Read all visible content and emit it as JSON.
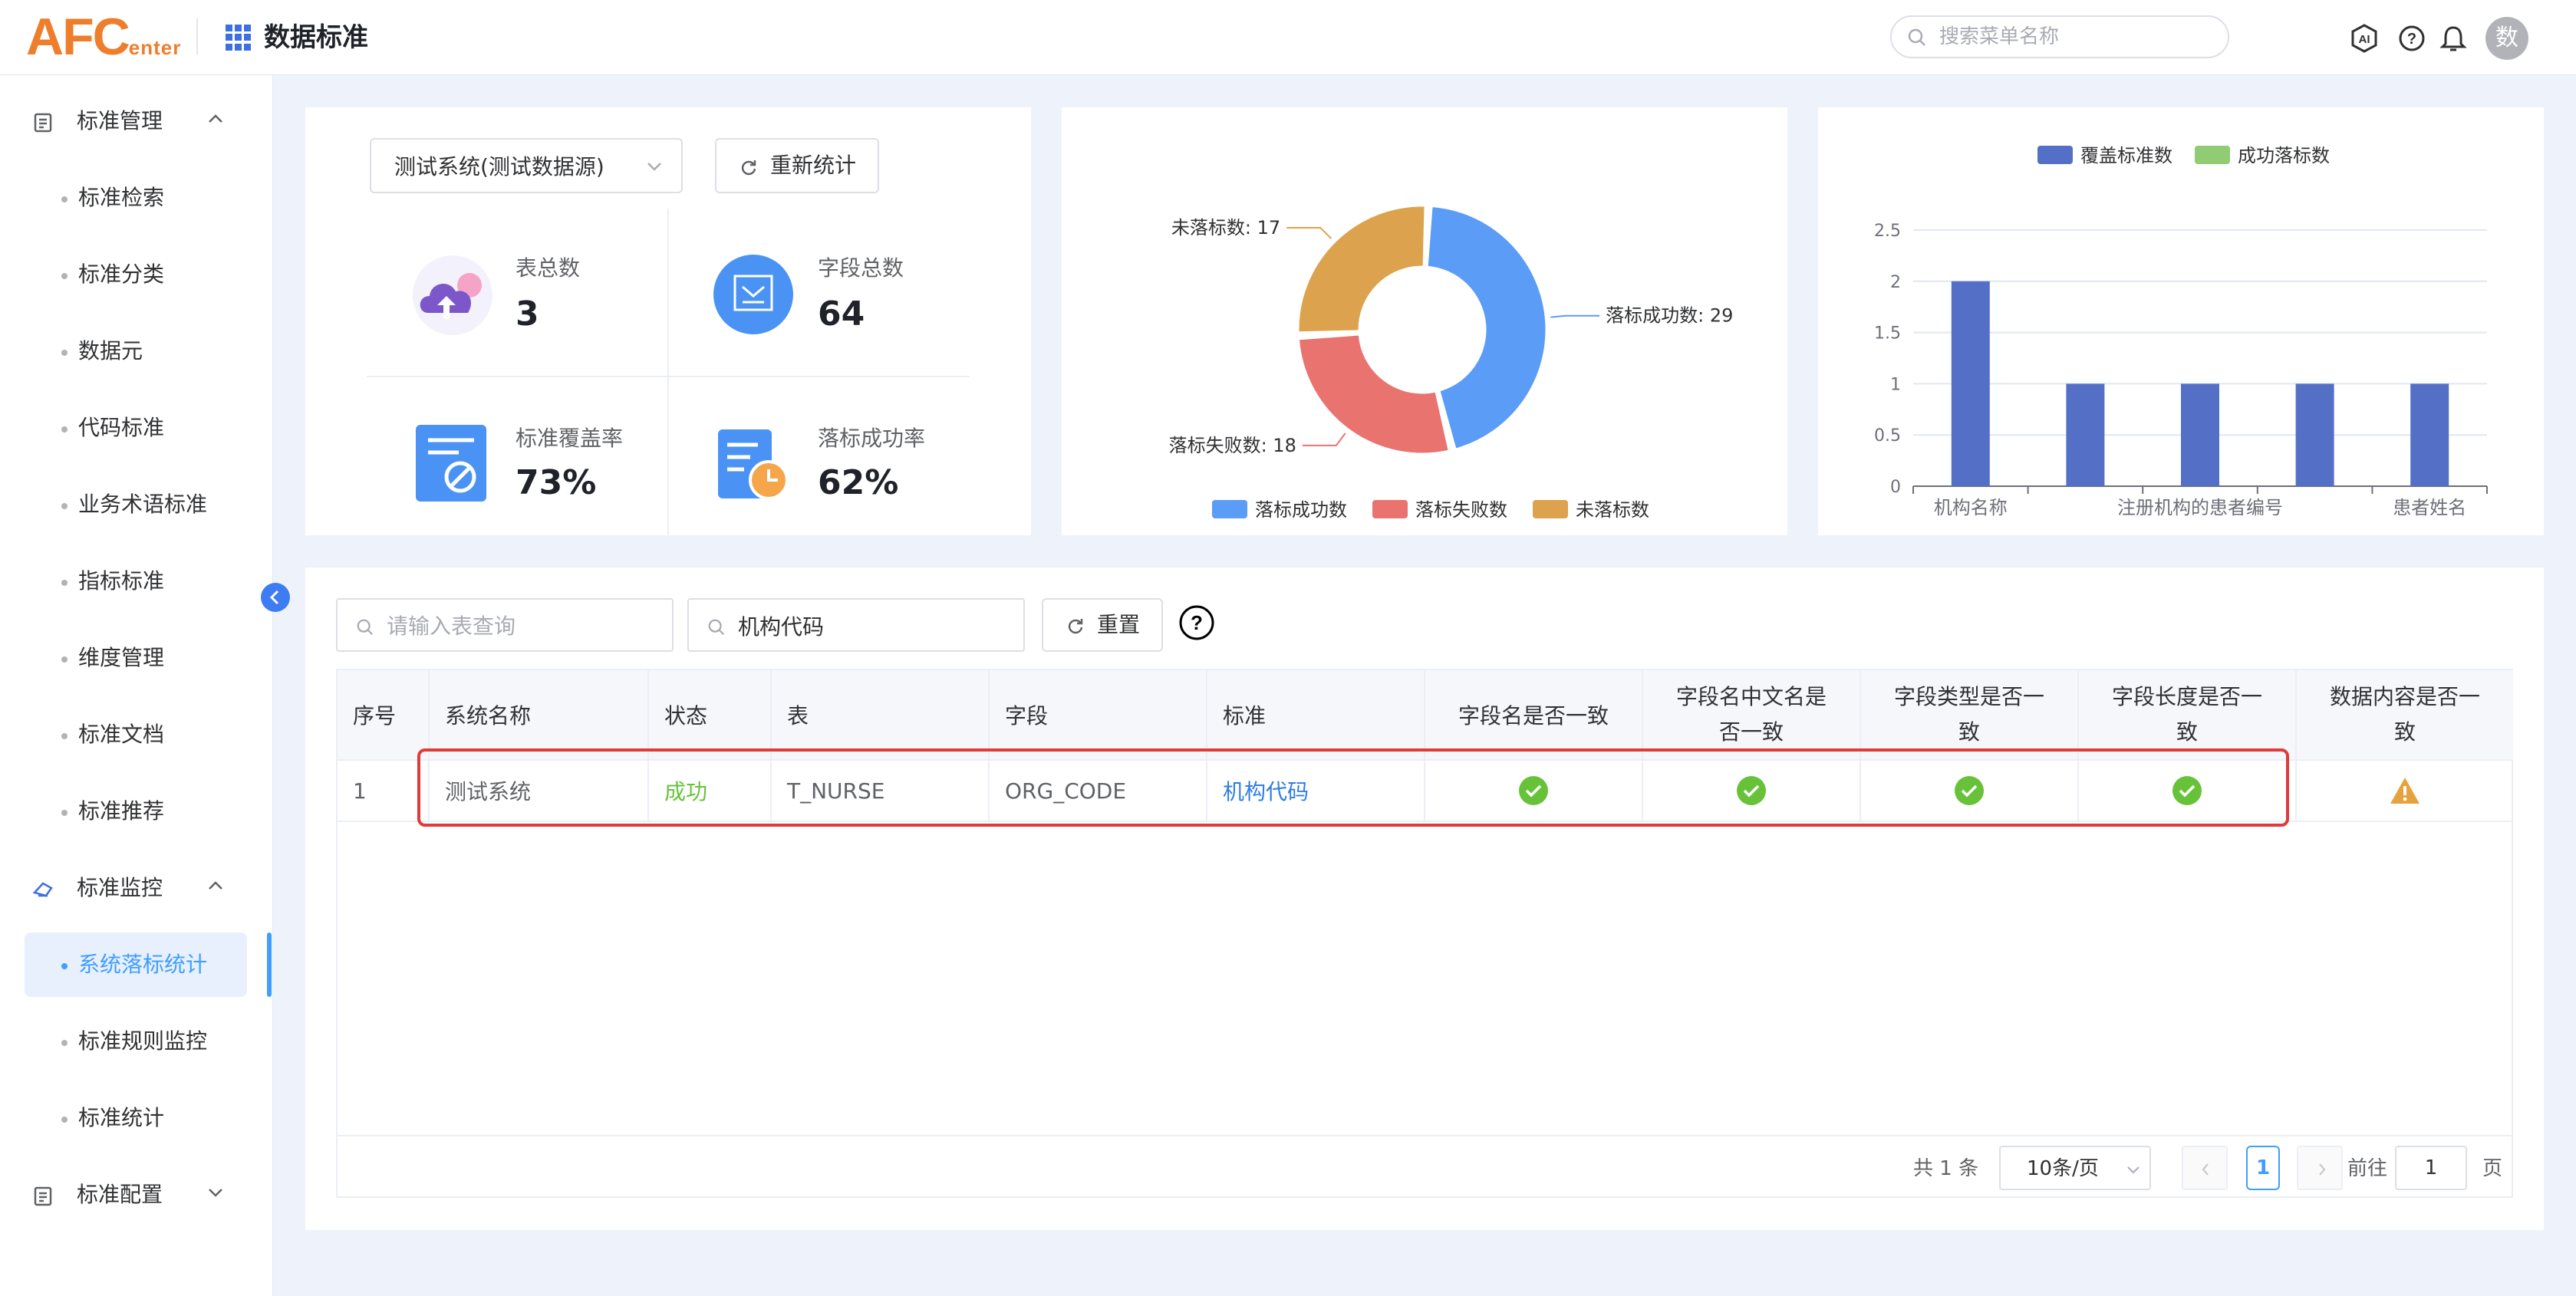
{
  "header": {
    "logo_main": "AFC",
    "logo_sub": "enter",
    "app_title": "数据标准",
    "search_placeholder": "搜索菜单名称",
    "avatar_text": "数",
    "icons": [
      "ai-icon",
      "help-icon",
      "bell-icon"
    ]
  },
  "sidebar": {
    "groups": [
      {
        "label": "标准管理",
        "icon": "document-icon",
        "expanded": true
      },
      {
        "label": "标准监控",
        "icon": "monitor-icon",
        "expanded": true
      },
      {
        "label": "标准配置",
        "icon": "document-icon",
        "expanded": false
      }
    ],
    "items": [
      {
        "label": "标准检索"
      },
      {
        "label": "标准分类"
      },
      {
        "label": "数据元"
      },
      {
        "label": "代码标准"
      },
      {
        "label": "业务术语标准"
      },
      {
        "label": "指标标准"
      },
      {
        "label": "维度管理"
      },
      {
        "label": "标准文档"
      },
      {
        "label": "标准推荐"
      },
      {
        "label": "系统落标统计",
        "active": true
      },
      {
        "label": "标准规则监控"
      },
      {
        "label": "标准统计"
      }
    ]
  },
  "stats": {
    "source_select": "测试系统(测试数据源)",
    "recount_button": "重新统计",
    "table_total_label": "表总数",
    "table_total_value": "3",
    "field_total_label": "字段总数",
    "field_total_value": "64",
    "coverage_label": "标准覆盖率",
    "coverage_value": "73%",
    "success_rate_label": "落标成功率",
    "success_rate_value": "62%"
  },
  "chart_data": [
    {
      "type": "pie",
      "donut": true,
      "labels": [
        "落标成功数",
        "落标失败数",
        "未落标数"
      ],
      "values": [
        29,
        18,
        17
      ],
      "slice_labels": [
        "落标成功数: 29",
        "落标失败数: 18",
        "未落标数: 17"
      ],
      "colors": [
        "#5b9cf6",
        "#e8736f",
        "#dda24d"
      ],
      "legend_position": "bottom"
    },
    {
      "type": "bar",
      "categories": [
        "机构名称",
        "",
        "注册机构的患者编号",
        "",
        "患者姓名"
      ],
      "series": [
        {
          "name": "覆盖标准数",
          "values": [
            2,
            1,
            1,
            1,
            1
          ],
          "color": "#5470c6"
        },
        {
          "name": "成功落标数",
          "values": [
            0,
            0,
            0,
            0,
            0
          ],
          "color": "#91cc75"
        }
      ],
      "ylim": [
        0,
        2.5
      ],
      "yticks": [
        "0",
        "0.5",
        "1",
        "1.5",
        "2",
        "2.5"
      ],
      "grid": true,
      "legend_position": "top"
    }
  ],
  "filters": {
    "table_query_placeholder": "请输入表查询",
    "standard_query_value": "机构代码",
    "reset_button": "重置"
  },
  "table": {
    "columns": [
      "序号",
      "系统名称",
      "状态",
      "表",
      "字段",
      "标准",
      "字段名是否一致",
      "字段名中文名是否一致",
      "字段类型是否一致",
      "字段长度是否一致",
      "数据内容是否一致"
    ],
    "column_lines": [
      [
        "字段名是否一致"
      ],
      [
        "字段名中文名是",
        "否一致"
      ],
      [
        "字段类型是否一",
        "致"
      ],
      [
        "字段长度是否一",
        "致"
      ],
      [
        "数据内容是否一",
        "致"
      ]
    ],
    "rows": [
      {
        "index": "1",
        "system": "测试系统",
        "status": "成功",
        "table": "T_NURSE",
        "field": "ORG_CODE",
        "standard": "机构代码",
        "checks": [
          "ok",
          "ok",
          "ok",
          "ok",
          "warn"
        ]
      }
    ]
  },
  "pagination": {
    "total": "共 1 条",
    "page_size": "10条/页",
    "current_page": "1",
    "goto_label": "前往",
    "goto_value": "1",
    "page_suffix": "页"
  },
  "colors": {
    "accent": "#409eff",
    "success": "#67c23a",
    "warning": "#e6a23c",
    "logo": "#ef7e2c",
    "highlight_border": "#e03a3a"
  }
}
